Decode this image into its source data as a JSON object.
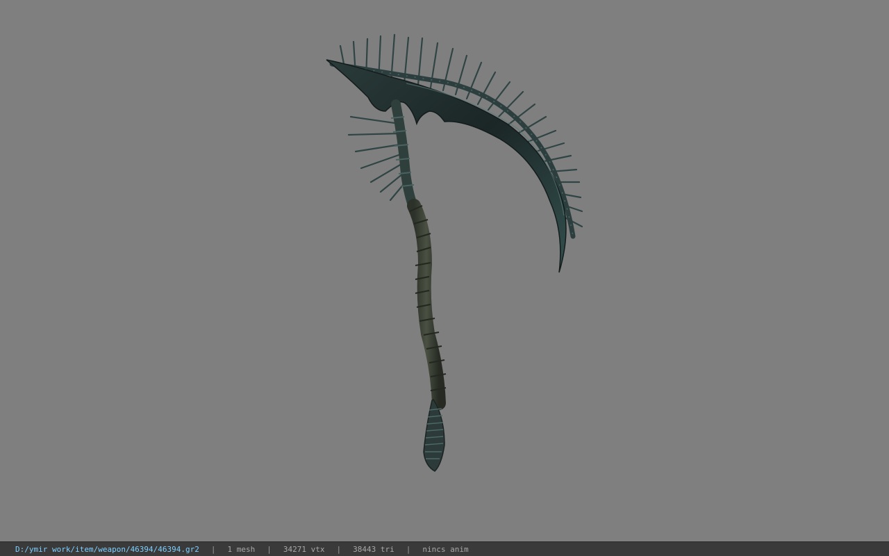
{
  "status_bar": {
    "file_path": "D:/ymir work/item/weapon/46394/46394.gr2",
    "mesh_count": "1 mesh",
    "vertex_count": "34271 vtx",
    "triangle_count": "38443 tri",
    "animation": "nincs anim",
    "separator": "|"
  },
  "colors": {
    "viewport_background": "#7f7f7f",
    "status_bar_background": "#3a3a3a",
    "path_text": "#7fd0ff",
    "status_text": "#a8a8a8",
    "blade_dark": "#1f2b2b",
    "blade_edge": "#3c5554",
    "spike": "#2e4241",
    "handle_wrap": "#3d4236"
  },
  "viewport": {
    "model": "scythe-weapon"
  }
}
